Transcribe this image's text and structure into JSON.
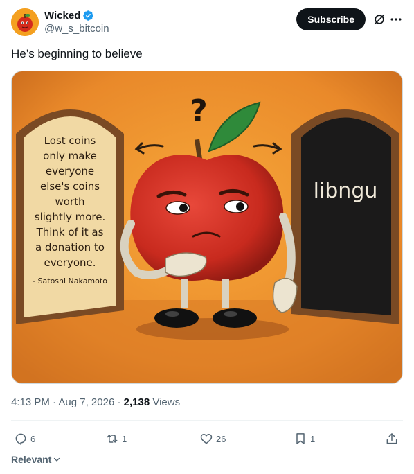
{
  "author": {
    "display_name": "Wicked",
    "handle": "@w_s_bitcoin",
    "verified": true
  },
  "header": {
    "subscribe_label": "Subscribe"
  },
  "tweet": {
    "text": "He’s beginning to believe"
  },
  "image": {
    "left_door_text": [
      "Lost coins",
      "only make",
      "everyone",
      "else's coins",
      "worth",
      "slightly more.",
      "Think of it as",
      "a donation to",
      "everyone."
    ],
    "left_door_attribution": "- Satoshi Nakamoto",
    "right_door_text": "libngu",
    "question_mark": "?"
  },
  "meta": {
    "time": "4:13 PM",
    "separator": "·",
    "date": "Aug 7, 2026",
    "views_count": "2,138",
    "views_label": "Views"
  },
  "actions": {
    "replies": "6",
    "reposts": "1",
    "likes": "26",
    "bookmarks": "1"
  },
  "sort": {
    "label": "Relevant"
  },
  "colors": {
    "accent": "#1d9bf0",
    "text_primary": "#0f1419",
    "text_secondary": "#536471",
    "subscribe_bg": "#0f1419"
  }
}
